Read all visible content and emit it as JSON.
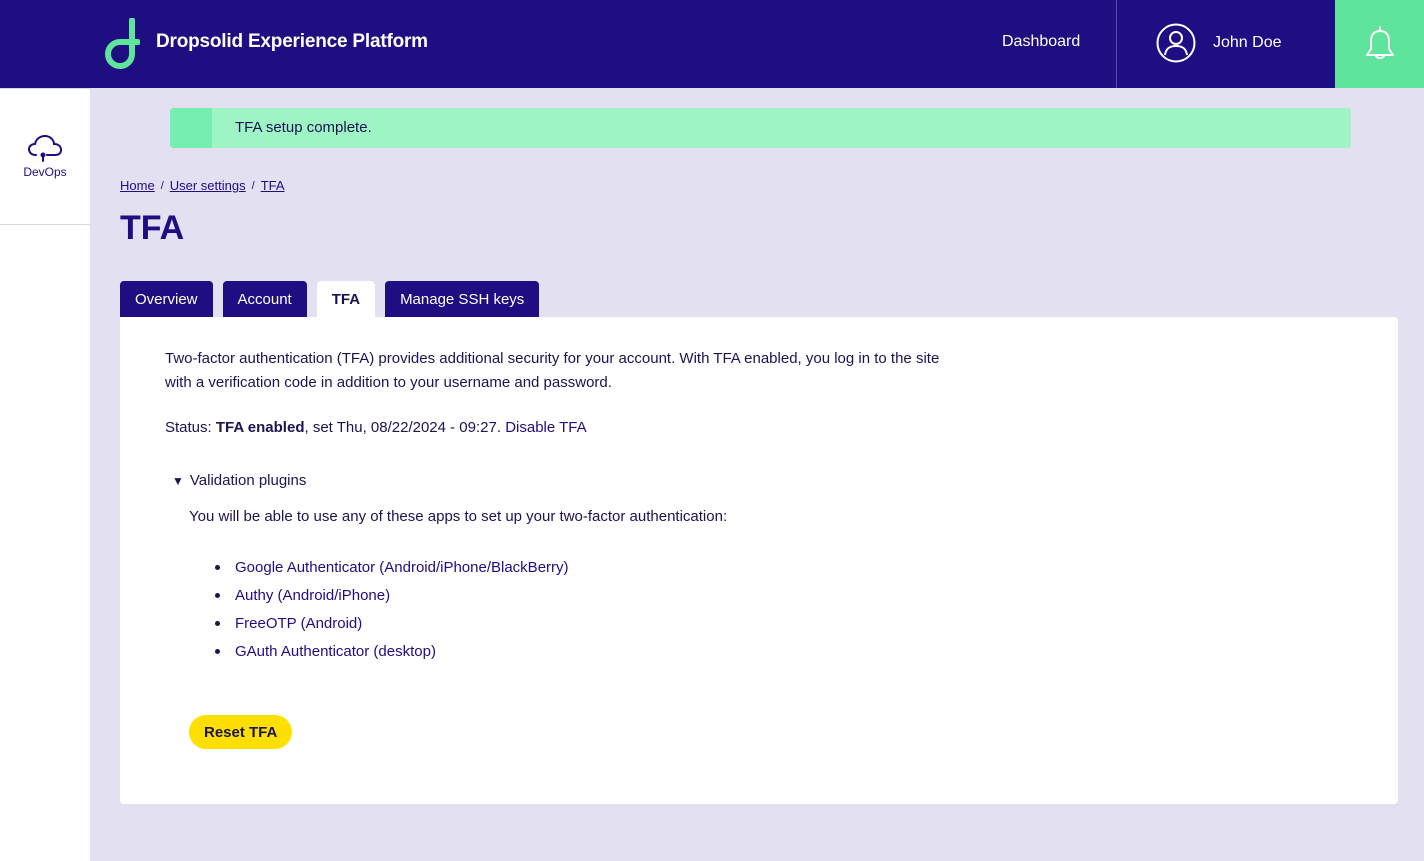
{
  "header": {
    "brand": "Dropsolid Experience Platform",
    "nav_dashboard": "Dashboard",
    "user_name": "John Doe",
    "icons": {
      "logo": "dropsolid-d-logo",
      "user": "user-circle-icon",
      "notifications": "bell-icon"
    }
  },
  "sidebar": {
    "items": [
      {
        "label": "DevOps",
        "icon": "cloud-icon"
      }
    ]
  },
  "message": {
    "text": "TFA setup complete."
  },
  "breadcrumb": {
    "items": [
      "Home",
      "User settings",
      "TFA"
    ],
    "separator": "/"
  },
  "page": {
    "title": "TFA"
  },
  "tabs": [
    {
      "label": "Overview",
      "active": false
    },
    {
      "label": "Account",
      "active": false
    },
    {
      "label": "TFA",
      "active": true
    },
    {
      "label": "Manage SSH keys",
      "active": false
    }
  ],
  "content": {
    "intro": "Two-factor authentication (TFA) provides additional security for your account. With TFA enabled, you log in to the site with a verification code in addition to your username and password.",
    "status_label": "Status: ",
    "status_value": "TFA enabled",
    "status_set": ", set Thu, 08/22/2024 - 09:27. ",
    "disable_link": "Disable TFA",
    "details_summary": "Validation plugins",
    "details_expanded": true,
    "apps_intro": "You will be able to use any of these apps to set up your two-factor authentication:",
    "apps": [
      "Google Authenticator (Android/iPhone/BlackBerry)",
      "Authy (Android/iPhone)",
      "FreeOTP (Android)",
      "GAuth Authenticator (desktop)"
    ],
    "reset_button": "Reset TFA"
  },
  "colors": {
    "primary": "#1e0e82",
    "accent_green": "#5ee59b",
    "message_bg": "#9ef4c4",
    "button_yellow": "#ffdf00",
    "page_bg": "#e3e0f1"
  }
}
